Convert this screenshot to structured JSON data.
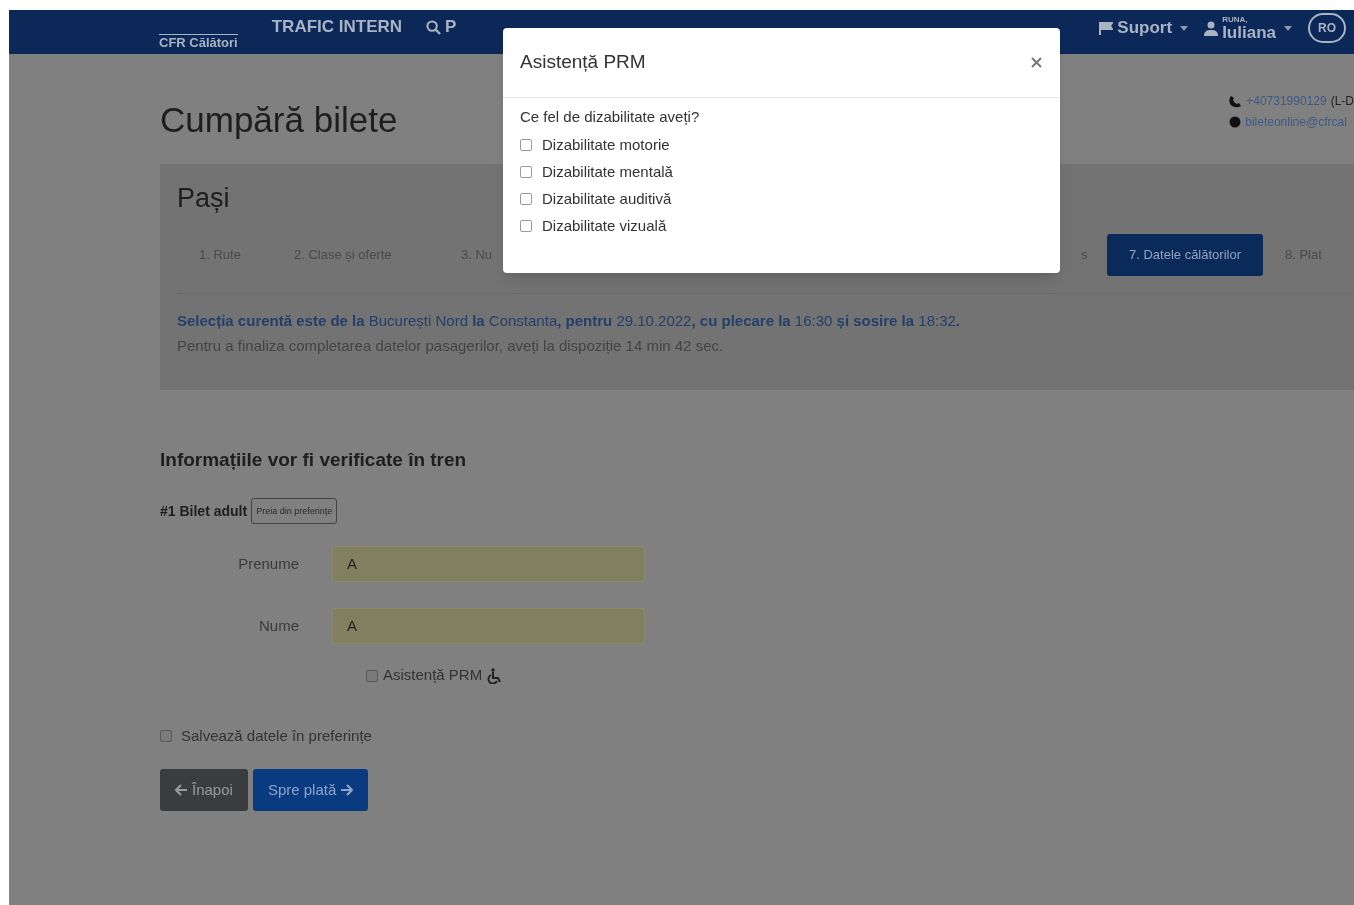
{
  "navbar": {
    "logo": "CFR Călători",
    "items": [
      {
        "kind": "text",
        "label": "TRAFIC INTERN"
      },
      {
        "kind": "search",
        "label": "P"
      }
    ],
    "right": [
      {
        "kind": "flag",
        "label": "Suport"
      },
      {
        "kind": "user",
        "label": "Iuliana",
        "sublabel": "RUNA,"
      }
    ],
    "language": "RO"
  },
  "page": {
    "title": "Cumpără bilete",
    "contact": {
      "phone": "+40731990129",
      "phone_note": "(L-D",
      "email": "bileteonline@cfrcal"
    }
  },
  "steps": {
    "title": "Pași",
    "items": [
      {
        "label": "1. Rute",
        "selected": false
      },
      {
        "label": "2. Clase și oferte",
        "selected": false
      },
      {
        "label": "3. Nu",
        "selected": false
      },
      {
        "label": "s",
        "selected": false
      },
      {
        "label": "7. Datele călătorilor",
        "selected": true
      },
      {
        "label": "8. Plat",
        "selected": false
      }
    ],
    "selection": "**Selecția curentă este de la** București Nord **la** Constanta**, pentru** 29.10.2022**, cu plecare la** 16:30 **și sosire la** 18:32**.**",
    "timer": "Pentru a finaliza completarea datelor pasagerilor, aveți la dispoziție 14 min 42 sec."
  },
  "form": {
    "heading": "Informațiile vor fi verificate în tren",
    "ticket": "#1 Bilet adult",
    "prefs_button": "Preia din preferințe",
    "fields": [
      {
        "label": "Prenume",
        "value": "A"
      },
      {
        "label": "Nume",
        "value": "A"
      }
    ],
    "prm": {
      "label": "Asistență PRM",
      "checked": false
    },
    "save": {
      "label": "Salvează datele în preferințe",
      "checked": false
    },
    "back": "Înapoi",
    "next": "Spre plată"
  },
  "modal": {
    "title": "Asistență PRM",
    "question": "Ce fel de dizabilitate aveți?",
    "options": [
      {
        "label": "Dizabilitate motorie",
        "checked": false
      },
      {
        "label": "Dizabilitate mentală",
        "checked": false
      },
      {
        "label": "Dizabilitate auditivă",
        "checked": false
      },
      {
        "label": "Dizabilitate vizuală",
        "checked": false
      }
    ]
  }
}
